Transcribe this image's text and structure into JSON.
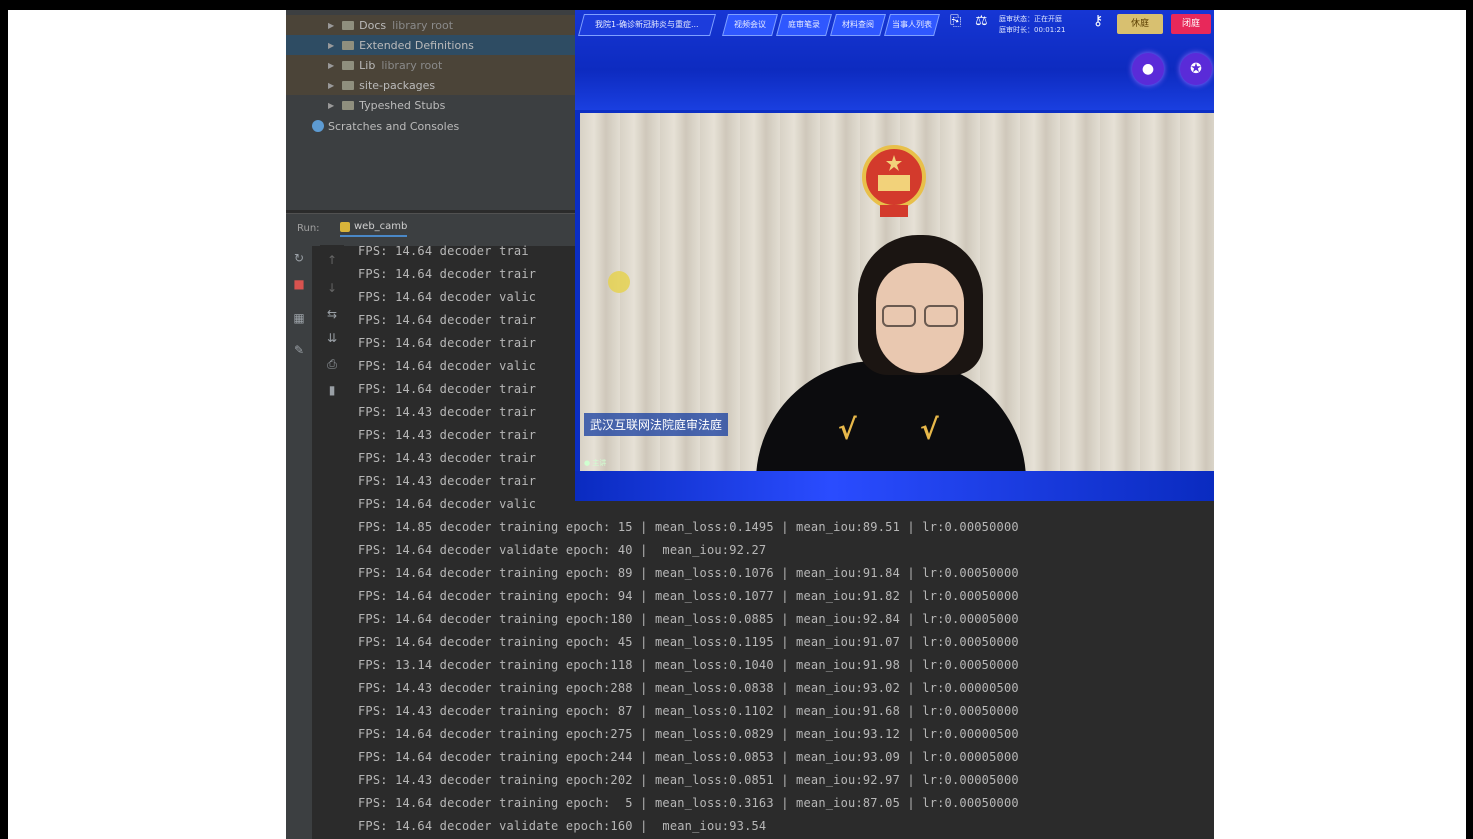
{
  "ide": {
    "project_tree": [
      {
        "label": "Docs",
        "sublabel": "library root",
        "style": "hl"
      },
      {
        "label": "Extended Definitions",
        "style": "sel"
      },
      {
        "label": "Lib",
        "sublabel": "library root",
        "style": "hl"
      },
      {
        "label": "site-packages",
        "style": "hl"
      },
      {
        "label": "Typeshed Stubs",
        "style": ""
      }
    ],
    "scratches_label": "Scratches and Consoles",
    "run_label": "Run:",
    "run_tab_label": "web_camb"
  },
  "console": {
    "lines": [
      "FPS: 14.64 decoder trai",
      "FPS: 14.64 decoder trair",
      "FPS: 14.64 decoder valic",
      "FPS: 14.64 decoder trair",
      "FPS: 14.64 decoder trair",
      "FPS: 14.64 decoder valic",
      "FPS: 14.64 decoder trair",
      "FPS: 14.43 decoder trair",
      "FPS: 14.43 decoder trair",
      "FPS: 14.43 decoder trair",
      "FPS: 14.43 decoder trair",
      "FPS: 14.64 decoder valic",
      "FPS: 14.85 decoder training epoch: 15 | mean_loss:0.1495 | mean_iou:89.51 | lr:0.00050000",
      "FPS: 14.64 decoder validate epoch: 40 |  mean_iou:92.27",
      "FPS: 14.64 decoder training epoch: 89 | mean_loss:0.1076 | mean_iou:91.84 | lr:0.00050000",
      "FPS: 14.64 decoder training epoch: 94 | mean_loss:0.1077 | mean_iou:91.82 | lr:0.00050000",
      "FPS: 14.64 decoder training epoch:180 | mean_loss:0.0885 | mean_iou:92.84 | lr:0.00005000",
      "FPS: 14.64 decoder training epoch: 45 | mean_loss:0.1195 | mean_iou:91.07 | lr:0.00050000",
      "FPS: 13.14 decoder training epoch:118 | mean_loss:0.1040 | mean_iou:91.98 | lr:0.00050000",
      "FPS: 14.43 decoder training epoch:288 | mean_loss:0.0838 | mean_iou:93.02 | lr:0.00000500",
      "FPS: 14.43 decoder training epoch: 87 | mean_loss:0.1102 | mean_iou:91.68 | lr:0.00050000",
      "FPS: 14.64 decoder training epoch:275 | mean_loss:0.0829 | mean_iou:93.12 | lr:0.00000500",
      "FPS: 14.64 decoder training epoch:244 | mean_loss:0.0853 | mean_iou:93.09 | lr:0.00005000",
      "FPS: 14.43 decoder training epoch:202 | mean_loss:0.0851 | mean_iou:92.97 | lr:0.00005000",
      "FPS: 14.64 decoder training epoch:  5 | mean_loss:0.3163 | mean_iou:87.05 | lr:0.00050000",
      "FPS: 14.64 decoder validate epoch:160 |  mean_iou:93.54"
    ]
  },
  "meeting": {
    "title_button": "我院1-确诊新冠肺炎与重症...",
    "toolbar_buttons": [
      "视频会议",
      "庭审笔录",
      "材料查阅",
      "当事人列表"
    ],
    "status_text_1": "庭审状态：正在开庭",
    "status_text_2": "庭审时长：00:01:21",
    "yellow_button": "休庭",
    "red_button": "闭庭",
    "caption": "武汉互联网法院庭审法庭",
    "video_status": "● 主讲"
  },
  "colors": {
    "ide_bg": "#2b2b2b",
    "console_text": "#b7b7b7",
    "meeting_blue": "#0b2ec4",
    "red_accent": "#e8285a"
  }
}
